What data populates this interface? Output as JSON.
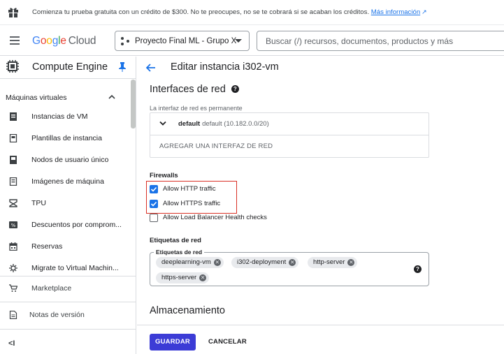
{
  "promo": {
    "text": "Comienza tu prueba gratuita con un crédito de $300. No te preocupes, no se te cobrará si se acaban los créditos.",
    "link": "Más información",
    "icon": "gift-icon"
  },
  "header": {
    "logo_google": "Google",
    "logo_cloud": "Cloud",
    "project": "Proyecto Final ML - Grupo X",
    "search_placeholder": "Buscar (/) recursos, documentos, productos y más"
  },
  "sidebar": {
    "product": "Compute Engine",
    "section": "Máquinas virtuales",
    "items": [
      {
        "label": "Instancias de VM",
        "icon": "vm-icon"
      },
      {
        "label": "Plantillas de instancia",
        "icon": "template-icon"
      },
      {
        "label": "Nodos de usuario único",
        "icon": "node-icon"
      },
      {
        "label": "Imágenes de máquina",
        "icon": "image-icon"
      },
      {
        "label": "TPU",
        "icon": "tpu-icon"
      },
      {
        "label": "Descuentos por comprom...",
        "icon": "discount-icon"
      },
      {
        "label": "Reservas",
        "icon": "calendar-icon"
      },
      {
        "label": "Migrate to Virtual Machin...",
        "icon": "migrate-icon"
      }
    ],
    "marketplace": "Marketplace",
    "release_notes": "Notas de versión",
    "collapse": "<I"
  },
  "main": {
    "title": "Editar instancia i302-vm",
    "network_heading": "Interfaces de red",
    "network_note": "La interfaz de red es permanente",
    "interface_name": "default",
    "interface_detail": "default (10.182.0.0/20)",
    "add_interface": "AGREGAR UNA INTERFAZ DE RED",
    "firewalls_label": "Firewalls",
    "checkboxes": [
      {
        "label": "Allow HTTP traffic",
        "checked": true
      },
      {
        "label": "Allow HTTPS traffic",
        "checked": true
      },
      {
        "label": "Allow Load Balancer Health checks",
        "checked": false
      }
    ],
    "tags_heading": "Etiquetas de red",
    "tags_legend": "Etiquetas de red",
    "tags": [
      "deeplearning-vm",
      "i302-deployment",
      "http-server",
      "https-server"
    ],
    "storage_heading": "Almacenamiento",
    "save_label": "GUARDAR",
    "cancel_label": "CANCELAR"
  },
  "colors": {
    "accent": "#1a73e8",
    "save_button": "#3c3cd6",
    "highlight_box": "#d93025"
  }
}
